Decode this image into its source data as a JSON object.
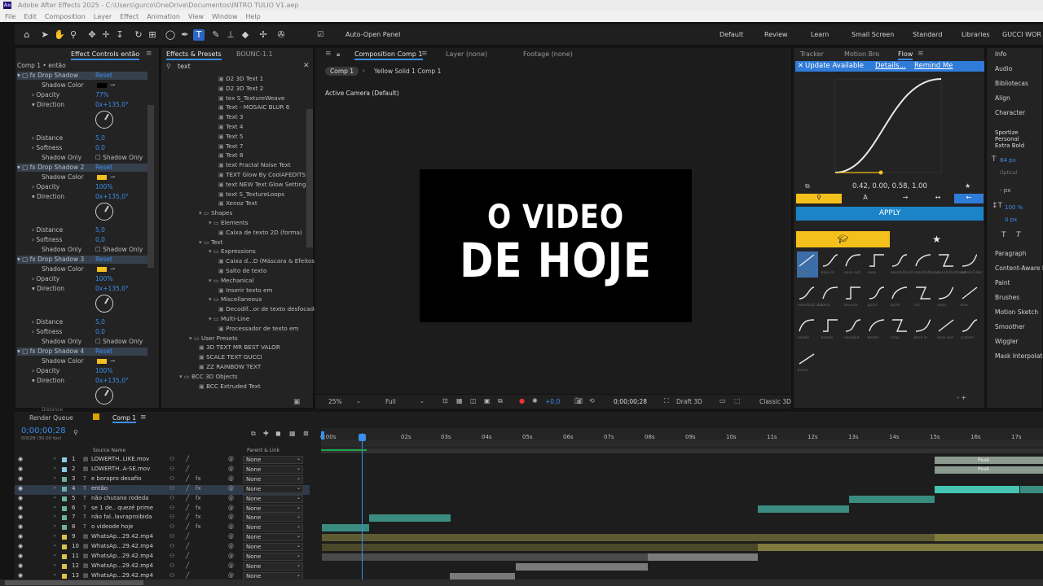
{
  "window": {
    "title": "Adobe After Effects 2025 - C:\\Users\\gurco\\OneDrive\\Documentos\\INTRO TULIO V1.aep",
    "app_logo": "Ae"
  },
  "menu": [
    "File",
    "Edit",
    "Composition",
    "Layer",
    "Effect",
    "Animation",
    "View",
    "Window",
    "Help"
  ],
  "toolbar": {
    "auto_open_panel": "Auto-Open Panel",
    "workspaces": [
      "Default",
      "Review",
      "Learn",
      "Small Screen",
      "Standard",
      "Libraries",
      "GUCCI WOR"
    ]
  },
  "effect_controls": {
    "tabs": [
      "Effect Controls então",
      "Effects & Presets",
      "BOUNC-1.1"
    ],
    "header": "Comp 1 • então",
    "groups": [
      {
        "name": "Drop Shadow",
        "reset": "Reset",
        "opacity": "77%",
        "direction": "0x+135,0°",
        "distance": "5,0",
        "softness": "0,0"
      },
      {
        "name": "Drop Shadow 2",
        "reset": "Reset",
        "opacity": "100%",
        "direction": "0x+135,0°",
        "distance": "5,0",
        "softness": "0,0"
      },
      {
        "name": "Drop Shadow 3",
        "reset": "Reset",
        "opacity": "100%",
        "direction": "0x+135,0°",
        "distance": "5,0",
        "softness": "0,0"
      },
      {
        "name": "Drop Shadow 4",
        "reset": "Reset",
        "opacity": "100%",
        "direction": "0x+135,0°"
      }
    ],
    "labels": {
      "shadow_color": "Shadow Color",
      "opacity": "Opacity",
      "direction": "Direction",
      "distance": "Distance",
      "softness": "Softness",
      "shadow_only": "Shadow Only",
      "shadow_only_cb": "Shadow Only"
    },
    "trailing": "Distance",
    "color_black": "#000000",
    "color_yellow": "#f4c01c"
  },
  "effects_presets": {
    "search": "text",
    "items": [
      {
        "t": "D2 3D Text 1",
        "d": 3
      },
      {
        "t": "D2 3D Text 2",
        "d": 3
      },
      {
        "t": "tex S_TextureWeave",
        "d": 3
      },
      {
        "t": "Text - MOSAIC BLUR 6",
        "d": 3
      },
      {
        "t": "Text 3",
        "d": 3
      },
      {
        "t": "Text 4",
        "d": 3
      },
      {
        "t": "Text 5",
        "d": 3
      },
      {
        "t": "Text 7",
        "d": 3
      },
      {
        "t": "Text 8",
        "d": 3
      },
      {
        "t": "text Fractal Noise Text",
        "d": 3
      },
      {
        "t": "TEXT Glow By CoolAFEDITS",
        "d": 3
      },
      {
        "t": "text NEW Text Glow Settings",
        "d": 3
      },
      {
        "t": "text S_TextureLoops",
        "d": 3
      },
      {
        "t": "Xenoz Text",
        "d": 3
      },
      {
        "t": "Shapes",
        "d": 1,
        "f": 1
      },
      {
        "t": "Elements",
        "d": 2,
        "f": 1
      },
      {
        "t": "Caixa de texto 2D (forma)",
        "d": 3
      },
      {
        "t": "Text",
        "d": 1,
        "f": 1
      },
      {
        "t": "Expressions",
        "d": 2,
        "f": 1
      },
      {
        "t": "Caixa d...D (Máscara & Efeitos)",
        "d": 3
      },
      {
        "t": "Salto de texto",
        "d": 3
      },
      {
        "t": "Mechanical",
        "d": 2,
        "f": 1
      },
      {
        "t": "Inserir texto em",
        "d": 3
      },
      {
        "t": "Miscellaneous",
        "d": 2,
        "f": 1
      },
      {
        "t": "Decodif...or de texto desfocado",
        "d": 3
      },
      {
        "t": "Multi-Line",
        "d": 2,
        "f": 1
      },
      {
        "t": "Processador de texto em",
        "d": 3
      },
      {
        "t": "User Presets",
        "d": 0,
        "f": 1
      },
      {
        "t": "3D TEXT MR BEST VALOR",
        "d": 1
      },
      {
        "t": "SCALE TEXT GUCCI",
        "d": 1
      },
      {
        "t": "ZZ RAINBOW TEXT",
        "d": 1
      },
      {
        "t": "BCC 3D Objects",
        "d": -1,
        "f": 1
      },
      {
        "t": "BCC Extruded Text",
        "d": 1
      }
    ]
  },
  "composition": {
    "tabs": [
      "Composition Comp 1",
      "Layer (none)",
      "Footage (none)"
    ],
    "breadcrumb": [
      "Comp 1",
      "Yellow Solid 1 Comp 1"
    ],
    "camera": "Active Camera (Default)",
    "title_line1": "O VIDEO",
    "title_line2": "DE HOJE",
    "footer": {
      "zoom": "25%",
      "resolution": "Full",
      "timecode": "0;00;00;28",
      "renderer": "Draft 3D",
      "mode": "Classic 3D",
      "exposure": "+0,0"
    }
  },
  "flow": {
    "tabs": [
      "Tracker",
      "Motion Bro",
      "Flow"
    ],
    "update": {
      "text": "Update Available",
      "details": "Details...",
      "remind": "Remind Me"
    },
    "bezier": "0.42, 0.00, 0.58, 1.00",
    "apply": "APPLY",
    "captions": [
      "linear",
      "ease in",
      "ease out",
      "ease",
      "easeInQuad",
      "easeOutQuad",
      "easeInOutQuad",
      "easeInCubic",
      "easeOutCubic",
      "back",
      "bounce",
      "quart",
      "quint",
      "circ",
      "expo",
      "sine",
      "elastic",
      "easeIn",
      "easeOut",
      "bezier",
      "snap",
      "back in",
      "back out",
      "custom"
    ],
    "last_caption": "linear",
    "footer": "- +"
  },
  "right_panel": {
    "items": [
      "Info",
      "Audio",
      "Bibliotecas",
      "Align",
      "Character"
    ],
    "font": "Sportize Personal",
    "style": "Extra Bold",
    "size": "84 px",
    "leading": "Optical",
    "tracking": "- px",
    "scale": "100 %",
    "baseline": "0 px",
    "lower": [
      "Paragraph",
      "Content-Aware Fill",
      "Paint",
      "Brushes",
      "Motion Sketch",
      "Smoother",
      "Wiggler",
      "Mask Interpolation"
    ]
  },
  "timeline": {
    "tabs": [
      "Render Queue",
      "Comp 1"
    ],
    "timecode": "0;00;00;28",
    "frames": "00028 (30.00 fps)",
    "col_source": "Source Name",
    "col_parent": "Parent & Link",
    "ticks": [
      "0:00s",
      "02s",
      "03s",
      "04s",
      "05s",
      "06s",
      "07s",
      "08s",
      "09s",
      "10s",
      "11s",
      "12s",
      "13s",
      "14s",
      "15s",
      "16s",
      "17s"
    ],
    "layers": [
      {
        "n": "1",
        "name": "LOWERTH..LIKE.mov",
        "parent": "None"
      },
      {
        "n": "2",
        "name": "LOWERTH..A-SE.mov",
        "parent": "None"
      },
      {
        "n": "3",
        "name": "e borapro desafio",
        "parent": "None"
      },
      {
        "n": "4",
        "name": "então",
        "parent": "None"
      },
      {
        "n": "5",
        "name": "não chutano rodeda",
        "parent": "None"
      },
      {
        "n": "6",
        "name": "se 1 de.. quezé prime",
        "parent": "None"
      },
      {
        "n": "7",
        "name": "não fal..lavraproibida",
        "parent": "None"
      },
      {
        "n": "8",
        "name": "o videode hoje",
        "parent": "None"
      },
      {
        "n": "9",
        "name": "WhatsAp...29.42.mp4",
        "parent": "None"
      },
      {
        "n": "10",
        "name": "WhatsAp...29.42.mp4",
        "parent": "None"
      },
      {
        "n": "11",
        "name": "WhatsAp...29.42.mp4",
        "parent": "None"
      },
      {
        "n": "12",
        "name": "WhatsAp...29.42.mp4",
        "parent": "None"
      },
      {
        "n": "13",
        "name": "WhatsAp...29.42.mp4",
        "parent": "None"
      }
    ],
    "peak": "Peak"
  }
}
